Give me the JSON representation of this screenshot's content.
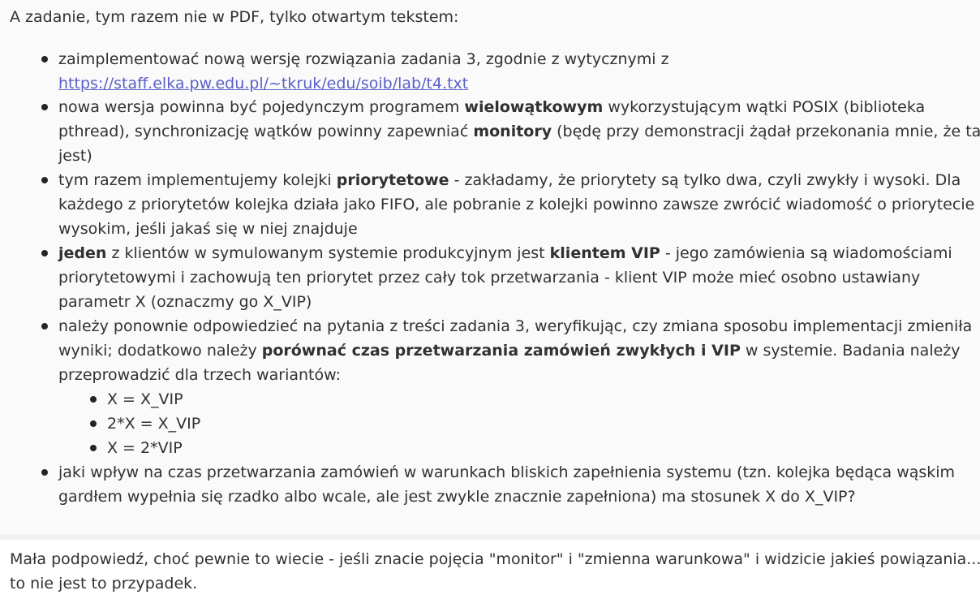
{
  "message1": {
    "intro": "A zadanie, tym razem nie w PDF, tylko otwartym tekstem:",
    "item1": {
      "l1": "zaimplementować nową wersję rozwiązania zadania 3, zgodnie z wytycznymi z",
      "link": "https://staff.elka.pw.edu.pl/~tkruk/edu/soib/lab/t4.txt"
    },
    "item2": {
      "a": "nowa wersja powinna być pojedynczym programem ",
      "b": "wielowątkowym",
      "c": " wykorzystującym wątki POSIX (biblioteka",
      "d": "pthread), synchronizację wątków powinny zapewniać ",
      "e": "monitory",
      "f": " (będę przy demonstracji żądał przekonania mnie, że tak",
      "g": "jest)"
    },
    "item3": {
      "a": "tym razem implementujemy kolejki ",
      "b": "priorytetowe",
      "c": " - zakładamy, że priorytety są tylko dwa, czyli zwykły i wysoki. Dla",
      "d": "każdego z priorytetów kolejka działa jako FIFO, ale pobranie z kolejki powinno zawsze zwrócić wiadomość o priorytecie",
      "e": "wysokim, jeśli jakaś się w niej znajduje"
    },
    "item4": {
      "a": "jeden",
      "b": " z klientów w symulowanym systemie produkcyjnym jest ",
      "c": "klientem VIP",
      "d": " - jego zamówienia są wiadomościami",
      "e": "priorytetowymi i zachowują ten priorytet przez cały tok przetwarzania - klient VIP może mieć osobno ustawiany",
      "f": "parametr X (oznaczmy go X_VIP)"
    },
    "item5": {
      "a": "należy ponownie odpowiedzieć na pytania z treści zadania 3, weryfikując, czy zmiana sposobu implementacji zmieniła",
      "b": "wyniki; dodatkowo należy ",
      "c": "porównać czas przetwarzania zamówień zwykłych i VIP",
      "d": " w systemie. Badania należy",
      "e": "przeprowadzić dla trzech wariantów:",
      "sub": [
        "X = X_VIP",
        "2*X = X_VIP",
        "X = 2*VIP"
      ]
    },
    "item6": {
      "a": "jaki wpływ na czas przetwarzania zamówień w warunkach bliskich zapełnienia systemu (tzn. kolejka będąca wąskim",
      "b": "gardłem wypełnia się rzadko albo wcale, ale jest zwykle znacznie zapełniona) ma stosunek X do X_VIP?"
    }
  },
  "message2": {
    "l1": "Mała podpowiedź, choć pewnie to wiecie - jeśli znacie pojęcia \"monitor\" i \"zmienna warunkowa\" i widzicie jakieś powiązania...",
    "l2": "to nie jest to przypadek."
  }
}
